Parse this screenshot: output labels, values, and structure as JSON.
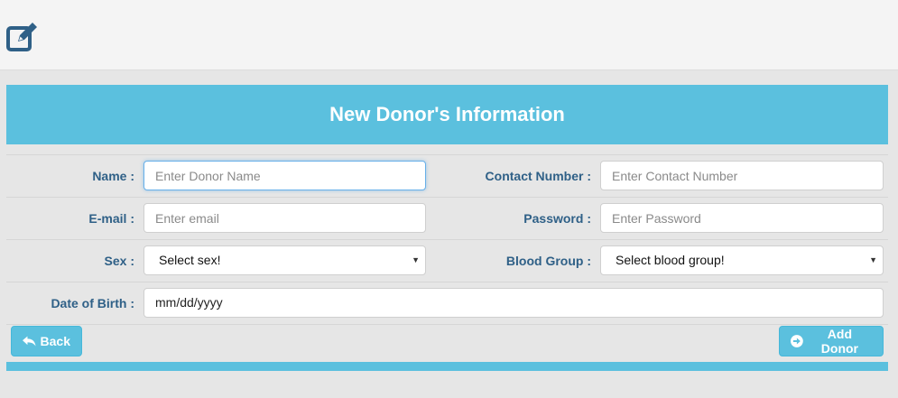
{
  "header": {
    "icon": "edit-icon"
  },
  "panel": {
    "title": "New Donor's Information"
  },
  "form": {
    "name": {
      "label": "Name :",
      "placeholder": "Enter Donor Name"
    },
    "contact": {
      "label": "Contact Number :",
      "placeholder": "Enter Contact Number"
    },
    "email": {
      "label": "E-mail :",
      "placeholder": "Enter email"
    },
    "password": {
      "label": "Password :",
      "placeholder": "Enter Password"
    },
    "sex": {
      "label": "Sex :",
      "selected": "Select sex!"
    },
    "blood_group": {
      "label": "Blood Group :",
      "selected": "Select blood group!"
    },
    "dob": {
      "label": "Date of Birth :",
      "value": "mm/dd/yyyy"
    }
  },
  "buttons": {
    "back": {
      "label": "Back",
      "icon": "reply-icon"
    },
    "add": {
      "label": "Add Donor",
      "icon": "arrow-circle-right-icon"
    }
  },
  "colors": {
    "accent": "#5bc0de",
    "label": "#2f6087",
    "icon": "#2f6087"
  }
}
